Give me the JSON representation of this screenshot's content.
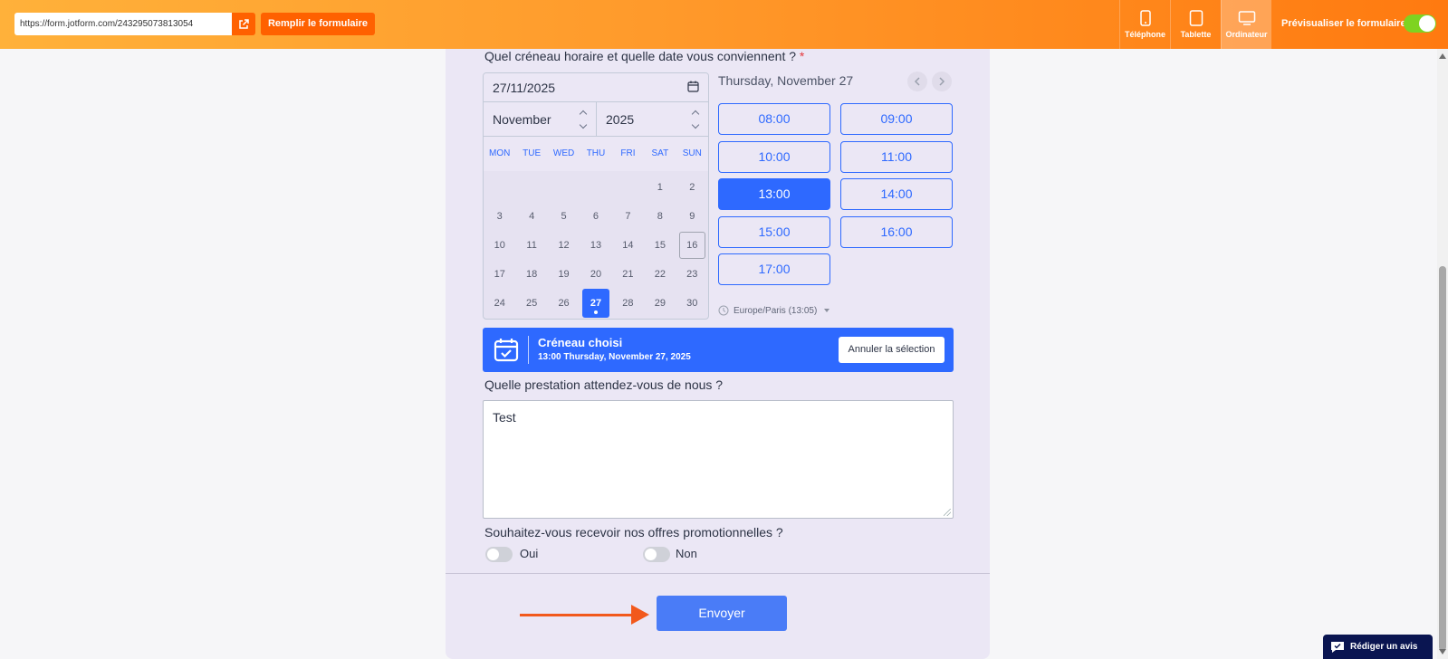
{
  "topbar": {
    "url": "https://form.jotform.com/243295073813054",
    "fill_button": "Remplir le formulaire",
    "devices": [
      {
        "label": "Téléphone",
        "icon": "phone-icon"
      },
      {
        "label": "Tablette",
        "icon": "tablet-icon"
      },
      {
        "label": "Ordinateur",
        "icon": "desktop-icon",
        "active": true
      }
    ],
    "preview_label": "Prévisualiser le formulaire",
    "preview_enabled": true,
    "colors": {
      "gradient_start": "#ffb13a",
      "gradient_end": "#ff7a10",
      "button": "#ff6100",
      "toggle_on": "#7ed321"
    }
  },
  "form": {
    "datetime_question": "Quel créneau horaire et quelle date vous conviennent ?",
    "required_mark": "*",
    "calendar": {
      "date_value": "27/11/2025",
      "month": "November",
      "year": "2025",
      "weekdays": [
        "MON",
        "TUE",
        "WED",
        "THU",
        "FRI",
        "SAT",
        "SUN"
      ],
      "weeks": [
        [
          "",
          "",
          "",
          "",
          "",
          "1",
          "2"
        ],
        [
          "3",
          "4",
          "5",
          "6",
          "7",
          "8",
          "9"
        ],
        [
          "10",
          "11",
          "12",
          "13",
          "14",
          "15",
          "16"
        ],
        [
          "17",
          "18",
          "19",
          "20",
          "21",
          "22",
          "23"
        ],
        [
          "24",
          "25",
          "26",
          "27",
          "28",
          "29",
          "30"
        ]
      ],
      "outlined_day": "16",
      "selected_day": "27"
    },
    "selected_date_heading": "Thursday, November 27",
    "time_slots": [
      "08:00",
      "09:00",
      "10:00",
      "11:00",
      "13:00",
      "14:00",
      "15:00",
      "16:00",
      "17:00"
    ],
    "selected_slot": "13:00",
    "timezone": "Europe/Paris (13:05)",
    "chosen_slot": {
      "title": "Créneau choisi",
      "detail": "13:00 Thursday, November 27, 2025",
      "cancel_label": "Annuler la sélection"
    },
    "service_question": "Quelle prestation attendez-vous de nous ?",
    "service_answer": "Test",
    "promo_question": "Souhaitez-vous recevoir nos offres promotionnelles ?",
    "promo_options": [
      "Oui",
      "Non"
    ],
    "submit_label": "Envoyer",
    "accent_color": "#2e69ff"
  },
  "review_button": "Rédiger un avis"
}
